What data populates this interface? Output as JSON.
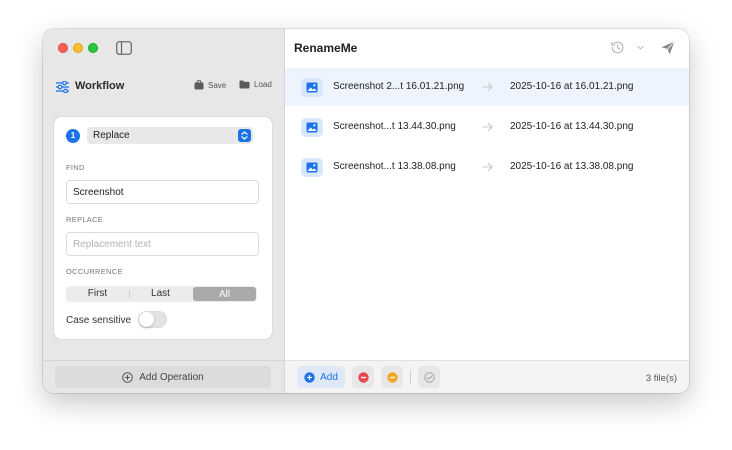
{
  "window": {
    "title": "RenameMe"
  },
  "sidebar": {
    "workflow_title": "Workflow",
    "save_label": "Save",
    "load_label": "Load",
    "operation": {
      "step_number": "1",
      "selected": "Replace",
      "find_label": "FIND",
      "find_value": "Screenshot",
      "replace_label": "REPLACE",
      "replace_placeholder": "Replacement text",
      "replace_value": "",
      "occurrence_label": "OCCURRENCE",
      "occurrence_options": [
        "First",
        "Last",
        "All"
      ],
      "occurrence_selected": "All",
      "case_sensitive_label": "Case sensitive",
      "case_sensitive": false
    },
    "add_operation_label": "Add Operation"
  },
  "files": [
    {
      "original": "Screenshot 2...t 16.01.21.png",
      "renamed": "2025-10-16 at 16.01.21.png",
      "selected": true
    },
    {
      "original": "Screenshot...t 13.44.30.png",
      "renamed": "2025-10-16 at 13.44.30.png",
      "selected": false
    },
    {
      "original": "Screenshot...t 13.38.08.png",
      "renamed": "2025-10-16 at 13.38.08.png",
      "selected": false
    }
  ],
  "footer": {
    "add_label": "Add",
    "file_count": "3 file(s)"
  },
  "icons": {
    "sidebar_toggle": "sidebar-toggle-icon",
    "workflow": "sliders-icon",
    "save": "briefcase-icon",
    "load": "folder-icon",
    "add_operation": "plus-circle-icon",
    "history": "clock-icon",
    "dropdown": "chevron-down-icon",
    "send": "paper-plane-icon",
    "file": "image-icon",
    "arrow": "arrow-right-icon",
    "remove": "minus-circle-icon",
    "clear": "clear-circle-icon",
    "verify": "check-circle-icon"
  },
  "colors": {
    "accent": "#1a73e8",
    "selected_row": "#eef4fd",
    "remove": "#e5484d",
    "clear": "#f5a524",
    "traffic_red": "#fe5f57",
    "traffic_yellow": "#febc2e",
    "traffic_green": "#28c840"
  }
}
